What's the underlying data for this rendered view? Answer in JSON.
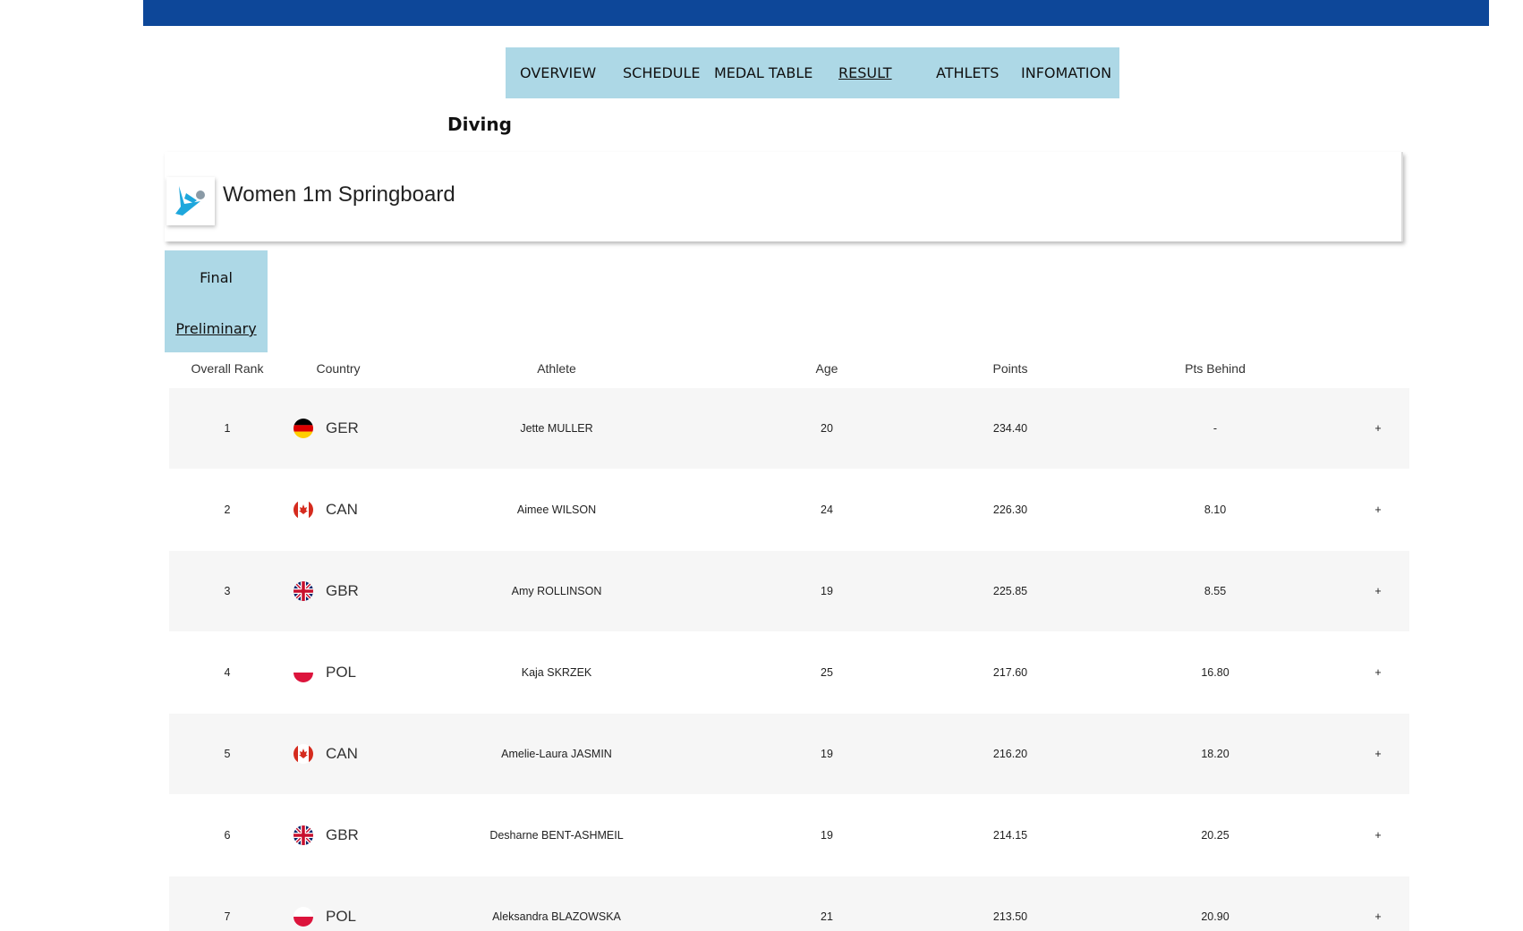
{
  "nav": {
    "items": [
      {
        "label": "OVERVIEW",
        "active": false
      },
      {
        "label": "SCHEDULE",
        "active": false
      },
      {
        "label": "MEDAL TABLE",
        "active": false
      },
      {
        "label": "RESULT",
        "active": true
      },
      {
        "label": "ATHLETS",
        "active": false
      },
      {
        "label": "INFOMATION",
        "active": false
      }
    ]
  },
  "sport": {
    "title": "Diving"
  },
  "event": {
    "title": "Women 1m Springboard",
    "icon": "diving-icon"
  },
  "phases": [
    {
      "label": "Final",
      "underlined": false
    },
    {
      "label": "Preliminary",
      "underlined": true
    }
  ],
  "table": {
    "headers": {
      "rank": "Overall Rank",
      "country": "Country",
      "athlete": "Athlete",
      "age": "Age",
      "points": "Points",
      "behind": "Pts Behind"
    },
    "rows": [
      {
        "rank": "1",
        "country": "GER",
        "flag": "germany-flag-icon",
        "athlete": "Jette MULLER",
        "age": "20",
        "points": "234.40",
        "behind": "-",
        "expand": "+"
      },
      {
        "rank": "2",
        "country": "CAN",
        "flag": "canada-flag-icon",
        "athlete": "Aimee WILSON",
        "age": "24",
        "points": "226.30",
        "behind": "8.10",
        "expand": "+"
      },
      {
        "rank": "3",
        "country": "GBR",
        "flag": "great-britain-flag-icon",
        "athlete": "Amy ROLLINSON",
        "age": "19",
        "points": "225.85",
        "behind": "8.55",
        "expand": "+"
      },
      {
        "rank": "4",
        "country": "POL",
        "flag": "poland-flag-icon",
        "athlete": "Kaja SKRZEK",
        "age": "25",
        "points": "217.60",
        "behind": "16.80",
        "expand": "+"
      },
      {
        "rank": "5",
        "country": "CAN",
        "flag": "canada-flag-icon",
        "athlete": "Amelie-Laura JASMIN",
        "age": "19",
        "points": "216.20",
        "behind": "18.20",
        "expand": "+"
      },
      {
        "rank": "6",
        "country": "GBR",
        "flag": "great-britain-flag-icon",
        "athlete": "Desharne BENT-ASHMEIL",
        "age": "19",
        "points": "214.15",
        "behind": "20.25",
        "expand": "+"
      },
      {
        "rank": "7",
        "country": "POL",
        "flag": "poland-flag-icon",
        "athlete": "Aleksandra BLAZOWSKA",
        "age": "21",
        "points": "213.50",
        "behind": "20.90",
        "expand": "+"
      }
    ]
  },
  "colors": {
    "topbar": "#0d4799",
    "nav_bg": "#add8e6",
    "row_shade": "#f6f6f6"
  }
}
